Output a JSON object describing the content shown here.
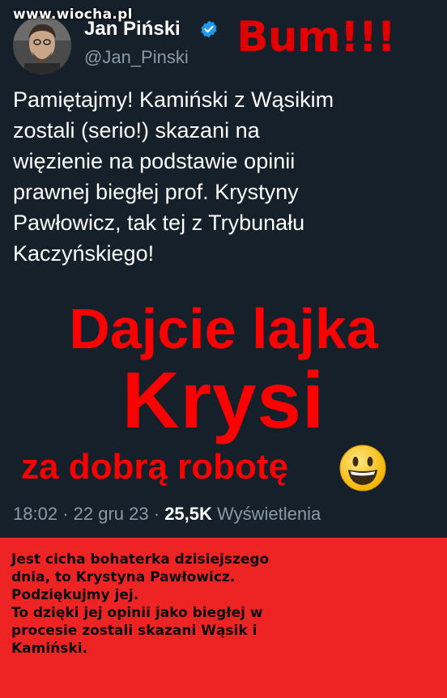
{
  "watermark": "www.wiocha.pl",
  "tweet": {
    "author_name": "Jan Piński",
    "handle": "@Jan_Pinski",
    "text_lines": [
      "Pamiętajmy! Kamiński z Wąsikim",
      "zostali (serio!) skazani na",
      "więzienie na podstawie opinii",
      "prawnej biegłej prof. Krystyny",
      "Pawłowicz, tak tej z Trybunału",
      "Kaczyńskiego!"
    ],
    "time": "18:02",
    "date": "22 gru 23",
    "views_count": "25,5K",
    "views_label": "Wyświetlenia",
    "separator": "·"
  },
  "overlay": {
    "exclaim": "Bum!!!",
    "line1": "Dajcie lajka",
    "line2": "Krysi",
    "line3": "za dobrą robotę"
  },
  "caption_lines": [
    "Jest cicha bohaterka dzisiejszego",
    "dnia, to Krystyna Pawłowicz.",
    "Podziękujmy jej.",
    "To dzięki jej opinii jako biegłej w",
    "procesie zostali skazani Wąsik i",
    "Kamiński."
  ],
  "colors": {
    "tweet_bg": "#15202b",
    "overlay_red": "#ff0000",
    "caption_bg": "#ee2424",
    "verified_blue": "#1d9bf0",
    "muted_text": "#8b98a5"
  }
}
